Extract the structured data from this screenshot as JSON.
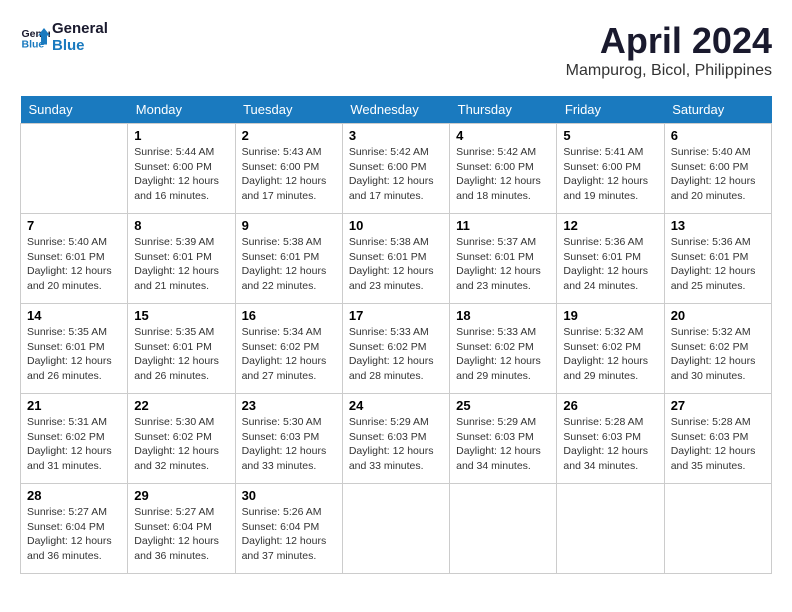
{
  "header": {
    "logo_line1": "General",
    "logo_line2": "Blue",
    "month_title": "April 2024",
    "location": "Mampurog, Bicol, Philippines"
  },
  "weekdays": [
    "Sunday",
    "Monday",
    "Tuesday",
    "Wednesday",
    "Thursday",
    "Friday",
    "Saturday"
  ],
  "weeks": [
    [
      {
        "day": "",
        "content": ""
      },
      {
        "day": "1",
        "content": "Sunrise: 5:44 AM\nSunset: 6:00 PM\nDaylight: 12 hours\nand 16 minutes."
      },
      {
        "day": "2",
        "content": "Sunrise: 5:43 AM\nSunset: 6:00 PM\nDaylight: 12 hours\nand 17 minutes."
      },
      {
        "day": "3",
        "content": "Sunrise: 5:42 AM\nSunset: 6:00 PM\nDaylight: 12 hours\nand 17 minutes."
      },
      {
        "day": "4",
        "content": "Sunrise: 5:42 AM\nSunset: 6:00 PM\nDaylight: 12 hours\nand 18 minutes."
      },
      {
        "day": "5",
        "content": "Sunrise: 5:41 AM\nSunset: 6:00 PM\nDaylight: 12 hours\nand 19 minutes."
      },
      {
        "day": "6",
        "content": "Sunrise: 5:40 AM\nSunset: 6:00 PM\nDaylight: 12 hours\nand 20 minutes."
      }
    ],
    [
      {
        "day": "7",
        "content": "Sunrise: 5:40 AM\nSunset: 6:01 PM\nDaylight: 12 hours\nand 20 minutes."
      },
      {
        "day": "8",
        "content": "Sunrise: 5:39 AM\nSunset: 6:01 PM\nDaylight: 12 hours\nand 21 minutes."
      },
      {
        "day": "9",
        "content": "Sunrise: 5:38 AM\nSunset: 6:01 PM\nDaylight: 12 hours\nand 22 minutes."
      },
      {
        "day": "10",
        "content": "Sunrise: 5:38 AM\nSunset: 6:01 PM\nDaylight: 12 hours\nand 23 minutes."
      },
      {
        "day": "11",
        "content": "Sunrise: 5:37 AM\nSunset: 6:01 PM\nDaylight: 12 hours\nand 23 minutes."
      },
      {
        "day": "12",
        "content": "Sunrise: 5:36 AM\nSunset: 6:01 PM\nDaylight: 12 hours\nand 24 minutes."
      },
      {
        "day": "13",
        "content": "Sunrise: 5:36 AM\nSunset: 6:01 PM\nDaylight: 12 hours\nand 25 minutes."
      }
    ],
    [
      {
        "day": "14",
        "content": "Sunrise: 5:35 AM\nSunset: 6:01 PM\nDaylight: 12 hours\nand 26 minutes."
      },
      {
        "day": "15",
        "content": "Sunrise: 5:35 AM\nSunset: 6:01 PM\nDaylight: 12 hours\nand 26 minutes."
      },
      {
        "day": "16",
        "content": "Sunrise: 5:34 AM\nSunset: 6:02 PM\nDaylight: 12 hours\nand 27 minutes."
      },
      {
        "day": "17",
        "content": "Sunrise: 5:33 AM\nSunset: 6:02 PM\nDaylight: 12 hours\nand 28 minutes."
      },
      {
        "day": "18",
        "content": "Sunrise: 5:33 AM\nSunset: 6:02 PM\nDaylight: 12 hours\nand 29 minutes."
      },
      {
        "day": "19",
        "content": "Sunrise: 5:32 AM\nSunset: 6:02 PM\nDaylight: 12 hours\nand 29 minutes."
      },
      {
        "day": "20",
        "content": "Sunrise: 5:32 AM\nSunset: 6:02 PM\nDaylight: 12 hours\nand 30 minutes."
      }
    ],
    [
      {
        "day": "21",
        "content": "Sunrise: 5:31 AM\nSunset: 6:02 PM\nDaylight: 12 hours\nand 31 minutes."
      },
      {
        "day": "22",
        "content": "Sunrise: 5:30 AM\nSunset: 6:02 PM\nDaylight: 12 hours\nand 32 minutes."
      },
      {
        "day": "23",
        "content": "Sunrise: 5:30 AM\nSunset: 6:03 PM\nDaylight: 12 hours\nand 33 minutes."
      },
      {
        "day": "24",
        "content": "Sunrise: 5:29 AM\nSunset: 6:03 PM\nDaylight: 12 hours\nand 33 minutes."
      },
      {
        "day": "25",
        "content": "Sunrise: 5:29 AM\nSunset: 6:03 PM\nDaylight: 12 hours\nand 34 minutes."
      },
      {
        "day": "26",
        "content": "Sunrise: 5:28 AM\nSunset: 6:03 PM\nDaylight: 12 hours\nand 34 minutes."
      },
      {
        "day": "27",
        "content": "Sunrise: 5:28 AM\nSunset: 6:03 PM\nDaylight: 12 hours\nand 35 minutes."
      }
    ],
    [
      {
        "day": "28",
        "content": "Sunrise: 5:27 AM\nSunset: 6:04 PM\nDaylight: 12 hours\nand 36 minutes."
      },
      {
        "day": "29",
        "content": "Sunrise: 5:27 AM\nSunset: 6:04 PM\nDaylight: 12 hours\nand 36 minutes."
      },
      {
        "day": "30",
        "content": "Sunrise: 5:26 AM\nSunset: 6:04 PM\nDaylight: 12 hours\nand 37 minutes."
      },
      {
        "day": "",
        "content": ""
      },
      {
        "day": "",
        "content": ""
      },
      {
        "day": "",
        "content": ""
      },
      {
        "day": "",
        "content": ""
      }
    ]
  ]
}
